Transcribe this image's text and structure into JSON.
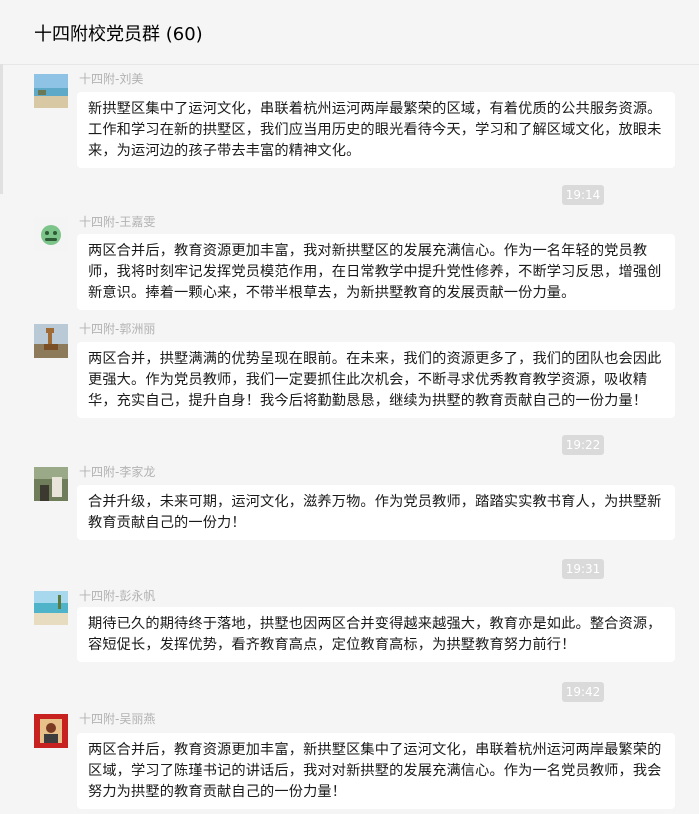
{
  "chat": {
    "title": "十四附校党员群 (60)"
  },
  "messages": [
    {
      "sender": "十四附-刘美",
      "text": "新拱墅区集中了运河文化，串联着杭州运河两岸最繁荣的区域，有着优质的公共服务资源。工作和学习在新的拱墅区，我们应当用历史的眼光看待今天，学习和了解区域文化，放眼未来，为运河边的孩子带去丰富的精神文化。"
    },
    {
      "sender": "十四附-王嘉雯",
      "text": "两区合并后，教育资源更加丰富，我对新拱墅区的发展充满信心。作为一名年轻的党员教师，我将时刻牢记发挥党员模范作用，在日常教学中提升党性修养，不断学习反思，增强创新意识。捧着一颗心来，不带半根草去，为新拱墅教育的发展贡献一份力量。"
    },
    {
      "sender": "十四附-郭洲丽",
      "text": "两区合并，拱墅满满的优势呈现在眼前。在未来，我们的资源更多了，我们的团队也会因此更强大。作为党员教师，我们一定要抓住此次机会，不断寻求优秀教育教学资源，吸收精华，充实自己，提升自身！我今后将勤勤恳恳，继续为拱墅的教育贡献自己的一份力量！"
    },
    {
      "sender": "十四附-李家龙",
      "text": "合并升级，未来可期，运河文化，滋养万物。作为党员教师，踏踏实实教书育人，为拱墅新教育贡献自己的一份力！"
    },
    {
      "sender": "十四附-彭永帆",
      "text": "期待已久的期待终于落地，拱墅也因两区合并变得越来越强大，教育亦是如此。整合资源，容短促长，发挥优势，看齐教育高点，定位教育高标，为拱墅教育努力前行！"
    },
    {
      "sender": "十四附-吴丽燕",
      "text": "两区合并后，教育资源更加丰富，新拱墅区集中了运河文化，串联着杭州运河两岸最繁荣的区域，学习了陈瑾书记的讲话后，我对对新拱墅的发展充满信心。作为一名党员教师，我会努力为拱墅的教育贡献自己的一份力量！"
    }
  ],
  "timestamps": [
    "19:14",
    "19:22",
    "19:31",
    "19:42"
  ]
}
